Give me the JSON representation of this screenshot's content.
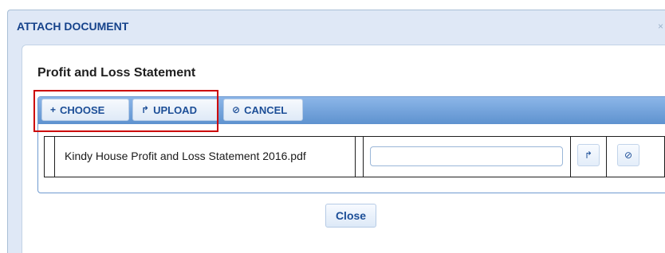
{
  "dialog": {
    "title": "ATTACH DOCUMENT",
    "close_glyph": "×"
  },
  "section": {
    "title": "Profit and Loss Statement"
  },
  "toolbar": {
    "choose_icon": "+",
    "choose_label": "CHOOSE",
    "upload_icon": "↱",
    "upload_label": "UPLOAD",
    "cancel_icon": "⊘",
    "cancel_label": "CANCEL"
  },
  "file": {
    "name": "Kindy House Profit and Loss Statement 2016.pdf",
    "description_value": "",
    "upload_icon": "↱",
    "cancel_icon": "⊘"
  },
  "footer": {
    "close_label": "Close"
  },
  "colors": {
    "title": "#15428b",
    "toolbar_gradient_top": "#8cb6e8",
    "toolbar_gradient_bottom": "#5e92cf",
    "highlight": "#cc0000"
  },
  "icons": {
    "choose": "plus-icon",
    "upload": "upload-icon",
    "cancel": "cancel-icon",
    "close": "close-icon"
  }
}
